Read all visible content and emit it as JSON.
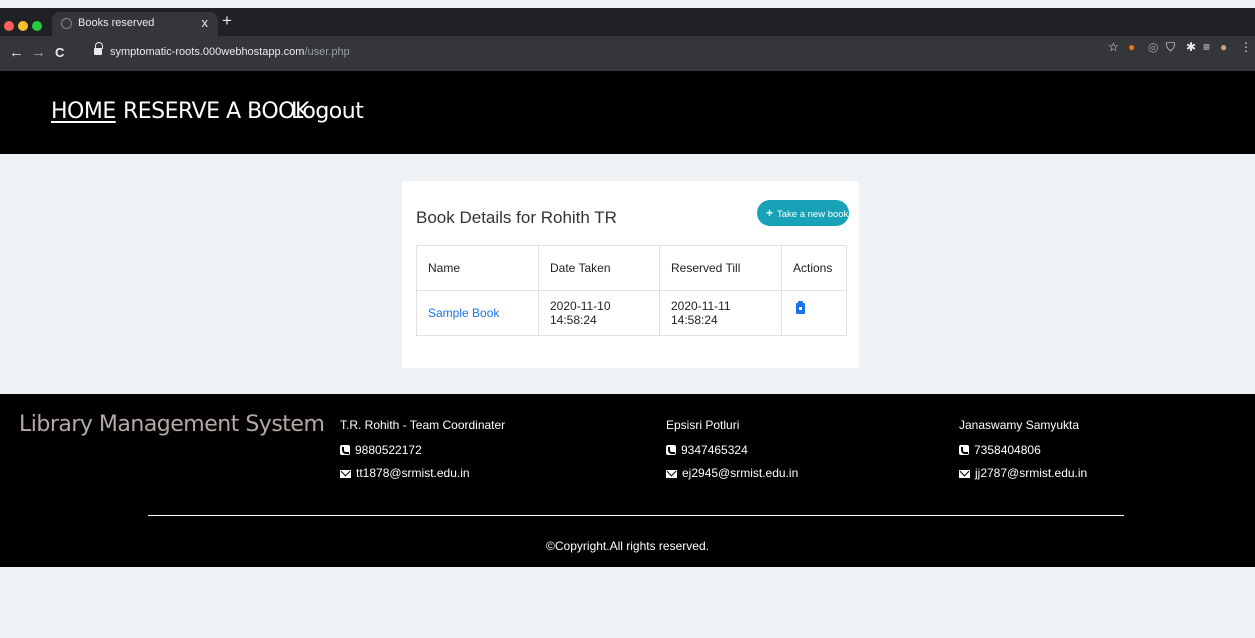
{
  "browser": {
    "tab_title": "Books reserved",
    "tab_close": "x",
    "new_tab": "+",
    "url_host": "symptomatic-roots.000webhostapp.com",
    "url_path": "/user.php",
    "back": "←",
    "forward": "→",
    "reload": "C",
    "traffic_colors": [
      "#ff5f57",
      "#febc2e",
      "#28c840"
    ]
  },
  "nav": {
    "home": "HOME",
    "reserve": "RESERVE A BOOK",
    "logout": "Logout"
  },
  "card": {
    "title": "Book Details for Rohith TR",
    "new_button": "Take a new book",
    "new_button_icon": "+",
    "columns": [
      "Name",
      "Date Taken",
      "Reserved Till",
      "Actions"
    ],
    "rows": [
      {
        "name": "Sample Book",
        "date_taken": "2020-11-10 14:58:24",
        "reserved_till": "2020-11-11 14:58:24",
        "action_icon": "clipboard-icon"
      }
    ]
  },
  "footer": {
    "brand": "Library Management System",
    "contacts": [
      {
        "name": "T.R. Rohith - Team Coordinater",
        "phone": "9880522172",
        "email": "tt1878@srmist.edu.in"
      },
      {
        "name": "Epsisri Potluri",
        "phone": "9347465324",
        "email": "ej2945@srmist.edu.in"
      },
      {
        "name": "Janaswamy Samyukta",
        "phone": "7358404806",
        "email": "jj2787@srmist.edu.in"
      }
    ],
    "copyright": "©Copyright.All rights reserved."
  },
  "colors": {
    "accent": "#17a2b8",
    "link": "#1a73e8",
    "header_bg": "#000000",
    "page_bg": "#eef2f5"
  }
}
